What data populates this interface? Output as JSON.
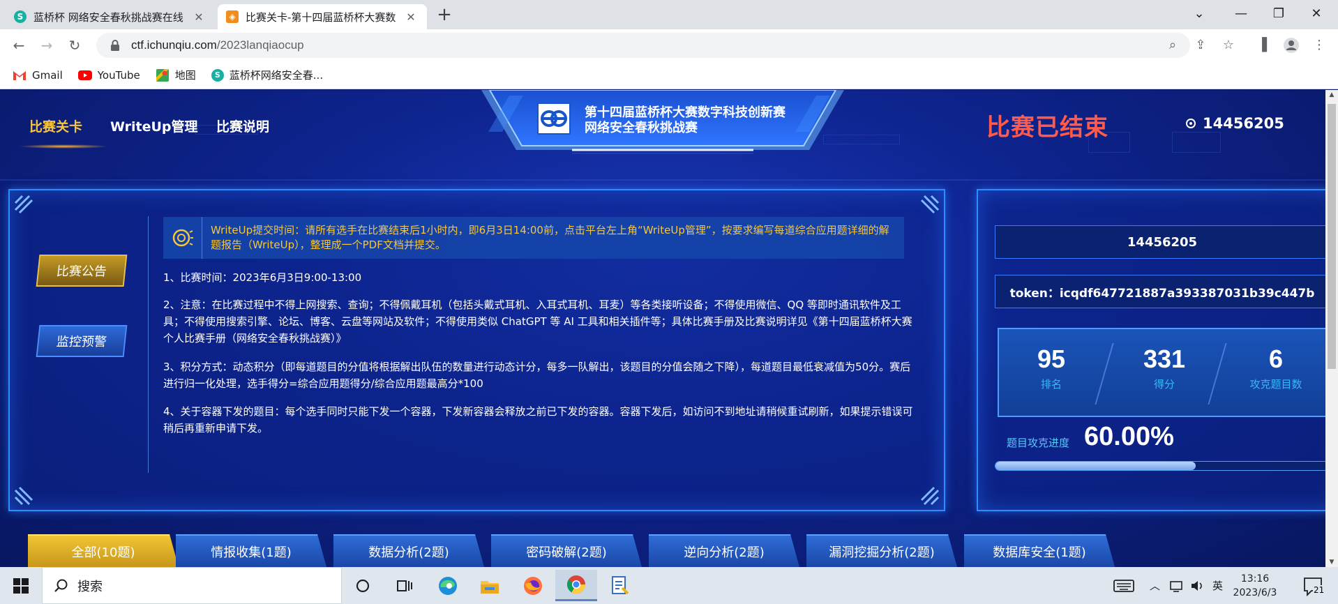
{
  "browser": {
    "tabs": [
      {
        "title": "蓝桥杯 网络安全春秋挑战赛在线",
        "favicon": "S-logo"
      },
      {
        "title": "比赛关卡-第十四届蓝桥杯大赛数",
        "favicon": "ichunqiu-logo"
      }
    ],
    "url_host": "ctf.ichunqiu.com",
    "url_path": "/2023lanqiaocup",
    "bookmarks": [
      {
        "label": "Gmail",
        "icon": "gmail-icon"
      },
      {
        "label": "YouTube",
        "icon": "youtube-icon"
      },
      {
        "label": "地图",
        "icon": "maps-icon"
      },
      {
        "label": "蓝桥杯网络安全春...",
        "icon": "S-logo"
      }
    ]
  },
  "page": {
    "nav": [
      "比赛关卡",
      "WriteUp管理",
      "比赛说明"
    ],
    "banner_line1": "第十四届蓝桥杯大赛数字科技创新赛",
    "banner_line2": "网络安全春秋挑战赛",
    "status": "比赛已结束",
    "user_id": "14456205",
    "side_buttons": [
      "比赛公告",
      "监控预警"
    ],
    "notice": "WriteUp提交时间：请所有选手在比赛结束后1小时内，即6月3日14:00前，点击平台左上角“WriteUp管理”，按要求编写每道综合应用题详细的解题报告（WriteUp），整理成一个PDF文档并提交。",
    "rules": [
      "1、比赛时间：2023年6月3日9:00-13:00",
      "2、注意：在比赛过程中不得上网搜索、查询；不得佩戴耳机（包括头戴式耳机、入耳式耳机、耳麦）等各类接听设备；不得使用微信、QQ 等即时通讯软件及工具；不得使用搜索引擎、论坛、博客、云盘等网站及软件；不得使用类似 ChatGPT 等 AI 工具和相关插件等；具体比赛手册及比赛说明详见《第十四届蓝桥杯大赛个人比赛手册（网络安全春秋挑战赛）》",
      "3、积分方式：动态积分（即每道题目的分值将根据解出队伍的数量进行动态计分，每多一队解出，该题目的分值会随之下降），每道题目最低衰减值为50分。赛后进行归一化处理，选手得分=综合应用题得分/综合应用题最高分*100",
      "4、关于容器下发的题目：每个选手同时只能下发一个容器，下发新容器会释放之前已下发的容器。容器下发后，如访问不到地址请稍候重试刷新，如果提示错误可稍后再重新申请下发。"
    ],
    "profile": {
      "id": "14456205",
      "token": "token：icqdf647721887a393387031b39c447b",
      "stats": [
        {
          "value": "95",
          "label": "排名"
        },
        {
          "value": "331",
          "label": "得分"
        },
        {
          "value": "6",
          "label": "攻克题目数"
        }
      ],
      "progress_label": "题目攻克进度",
      "progress_value": "60.00%",
      "progress_fraction": 0.6
    },
    "categories": [
      "全部(10题)",
      "情报收集(1题)",
      "数据分析(2题)",
      "密码破解(2题)",
      "逆向分析(2题)",
      "漏洞挖掘分析(2题)",
      "数据库安全(1题)"
    ]
  },
  "taskbar": {
    "search_placeholder": "搜索",
    "ime": "英",
    "time": "13:16",
    "date": "2023/6/3",
    "notif_count": "21"
  },
  "colors": {
    "accent_gold": "#f7c544",
    "status_red": "#ff5a4a",
    "label_cyan": "#37b7ff"
  }
}
